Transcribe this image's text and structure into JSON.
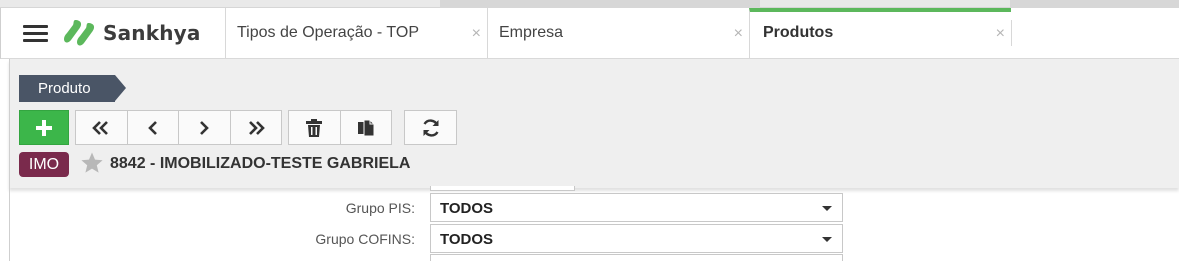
{
  "app": {
    "logo_text": "Sankhya",
    "brand_color": "#5cb85c"
  },
  "tabs": [
    {
      "label": "Tipos de Operação - TOP",
      "close": "×",
      "active": false
    },
    {
      "label": "Empresa",
      "close": "×",
      "active": false
    },
    {
      "label": "Produtos",
      "close": "×",
      "active": true
    }
  ],
  "breadcrumb": {
    "label": "Produto"
  },
  "toolbar": {
    "add_icon": "plus-icon",
    "nav_icons": [
      "first-record-icon",
      "previous-record-icon",
      "next-record-icon",
      "last-record-icon"
    ],
    "action_icons": [
      "trash-icon",
      "copy-icon"
    ],
    "refresh_icon": "refresh-icon"
  },
  "record": {
    "badge": "IMO",
    "badge_color": "#7a2a4c",
    "title": "8842 - IMOBILIZADO-TESTE GABRIELA",
    "favorite": false
  },
  "form": {
    "fields": [
      {
        "label": "Grupo PIS:",
        "value": "TODOS"
      },
      {
        "label": "Grupo COFINS:",
        "value": "TODOS"
      }
    ]
  }
}
